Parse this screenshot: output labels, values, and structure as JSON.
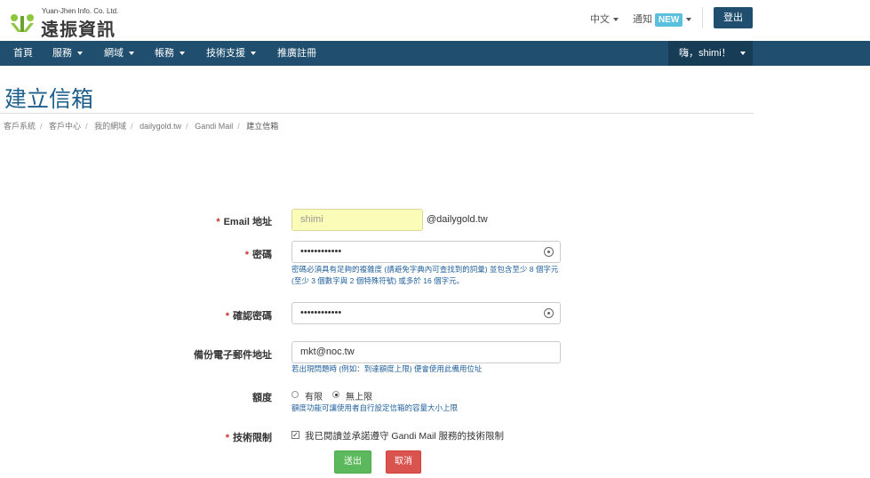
{
  "header": {
    "logo_subtitle": "Yuan-Jhen Info. Co. Ltd.",
    "logo_name": "遠振資訊",
    "language_label": "中文",
    "notify_label": "通知",
    "new_badge": "NEW",
    "logout_label": "登出"
  },
  "nav": {
    "items": [
      {
        "label": "首頁"
      },
      {
        "label": "服務"
      },
      {
        "label": "網域"
      },
      {
        "label": "帳務"
      },
      {
        "label": "技術支援"
      },
      {
        "label": "推廣註冊"
      }
    ],
    "user_greeting": "嗨，shimi！"
  },
  "page": {
    "title": "建立信箱",
    "breadcrumb": [
      "客戶系統",
      "客戶中心",
      "我的網域",
      "dailygold.tw",
      "Gandi Mail",
      "建立信箱"
    ]
  },
  "form": {
    "email": {
      "label": "Email 地址",
      "value": "shimi",
      "suffix": "@dailygold.tw"
    },
    "password": {
      "label": "密碼",
      "value": "••••••••••••",
      "help": "密碼必須具有足夠的複雜度 (請避免字典內可查找到的詞彙) 並包含至少 8 個字元 (至少 3 個數字與 2 個特殊符號) 或多於 16 個字元。"
    },
    "confirm": {
      "label": "確認密碼",
      "value": "••••••••••••"
    },
    "backup": {
      "label": "備份電子郵件地址",
      "value": "mkt@noc.tw",
      "help": "若出現問題時 (例如：到達額度上限) 便會使用此備用位址"
    },
    "quota": {
      "label": "額度",
      "options": [
        "有限",
        "無上限"
      ],
      "selected": "無上限",
      "help": "額度功能可讓使用者自行設定信箱的容量大小上限"
    },
    "tech": {
      "label": "技術限制",
      "checkbox_label": "我已閱讀並承諾遵守 Gandi Mail 服務的技術限制",
      "checked": true
    },
    "submit_label": "送出",
    "cancel_label": "取消"
  },
  "colors": {
    "navbar": "#1f4e6e",
    "title": "#1f5f8b",
    "required": "#c9302c",
    "help_text": "#1f5f9b",
    "submit": "#5cb85c",
    "cancel": "#d9534f",
    "email_highlight": "#fafcb7"
  }
}
